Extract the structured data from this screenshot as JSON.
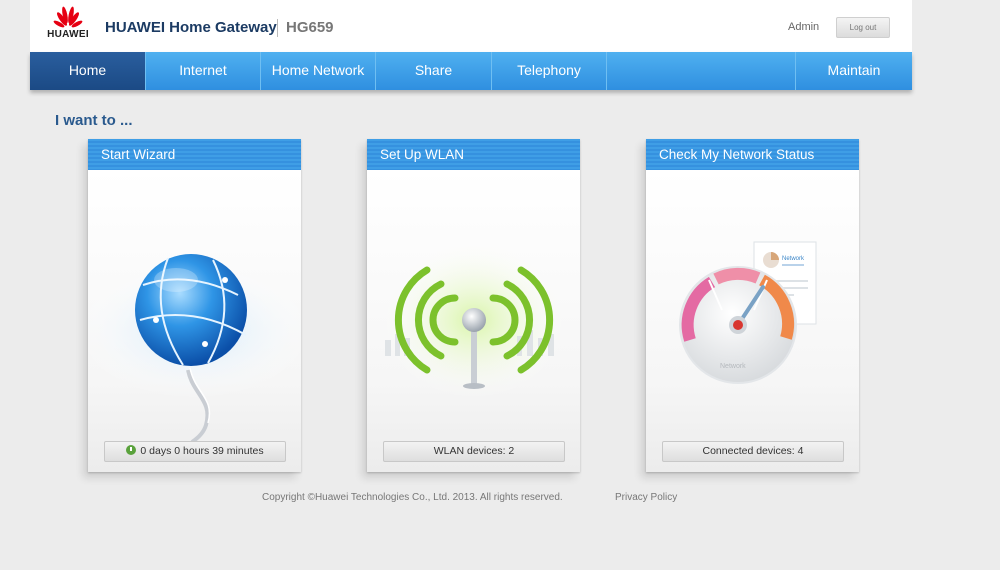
{
  "brand": {
    "logo_text": "HUAWEI",
    "product": "HUAWEI Home Gateway",
    "model": "HG659"
  },
  "user": {
    "name": "Admin",
    "logout_label": "Log out"
  },
  "nav": {
    "items": [
      {
        "label": "Home",
        "active": true
      },
      {
        "label": "Internet"
      },
      {
        "label": "Home Network"
      },
      {
        "label": "Share"
      },
      {
        "label": "Telephony"
      },
      {
        "label": "Maintain"
      }
    ]
  },
  "main": {
    "heading": "I want to ...",
    "cards": [
      {
        "title": "Start Wizard",
        "status": "0 days 0 hours 39 minutes",
        "icon": "globe-icon"
      },
      {
        "title": "Set Up WLAN",
        "status": "WLAN devices: 2",
        "icon": "wifi-antenna-icon"
      },
      {
        "title": "Check My Network Status",
        "status": "Connected devices: 4",
        "icon": "speed-gauge-icon",
        "gauge_label": "Network",
        "report_label": "Network"
      }
    ]
  },
  "footer": {
    "copyright": "Copyright ©Huawei Technologies Co., Ltd. 2013. All rights reserved.",
    "privacy": "Privacy Policy"
  },
  "colors": {
    "nav": "#3a9be6",
    "nav_active": "#1f4f8c",
    "card_header": "#3a98e4",
    "brand_red": "#e60012"
  }
}
